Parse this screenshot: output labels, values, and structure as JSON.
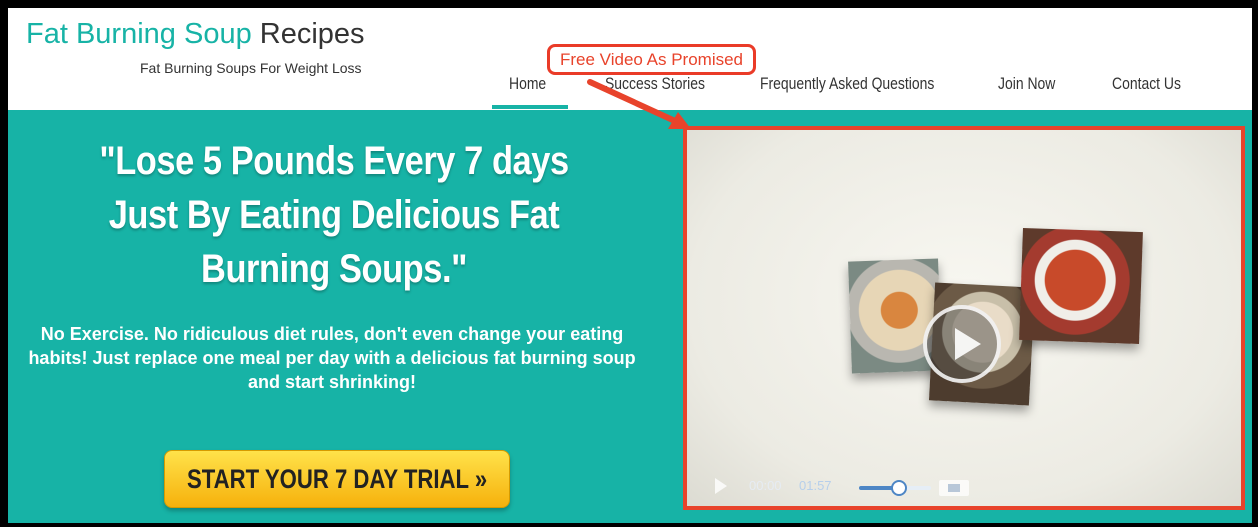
{
  "brand": {
    "name_part1": "Fat Burning Soup",
    "name_part2": "Recipes",
    "tagline": "Fat Burning Soups For Weight Loss"
  },
  "nav": {
    "items": [
      {
        "label": "Home",
        "active": true
      },
      {
        "label": "Success Stories",
        "active": false
      },
      {
        "label": "Frequently Asked Questions",
        "active": false
      },
      {
        "label": "Join Now",
        "active": false
      },
      {
        "label": "Contact Us",
        "active": false
      }
    ]
  },
  "hero": {
    "headline": "\"Lose 5 Pounds Every 7 days Just By Eating Delicious Fat Burning Soups.\"",
    "subtext": "No Exercise. No ridiculous diet rules, don't even change your eating habits! Just replace one meal per day with a delicious fat burning soup and start shrinking!",
    "cta_label": "START YOUR 7 DAY TRIAL",
    "cta_icon": "double-chevron-right-icon"
  },
  "video": {
    "elapsed": "00:00",
    "duration": "01:57",
    "volume_level": 0.55,
    "icons": [
      "play-icon",
      "volume-slider",
      "fullscreen-icon"
    ]
  },
  "annotation": {
    "label": "Free Video As Promised"
  },
  "colors": {
    "teal": "#17b3a6",
    "annotation_red": "#e8432b",
    "cta_yellow": "#f9c61c"
  }
}
